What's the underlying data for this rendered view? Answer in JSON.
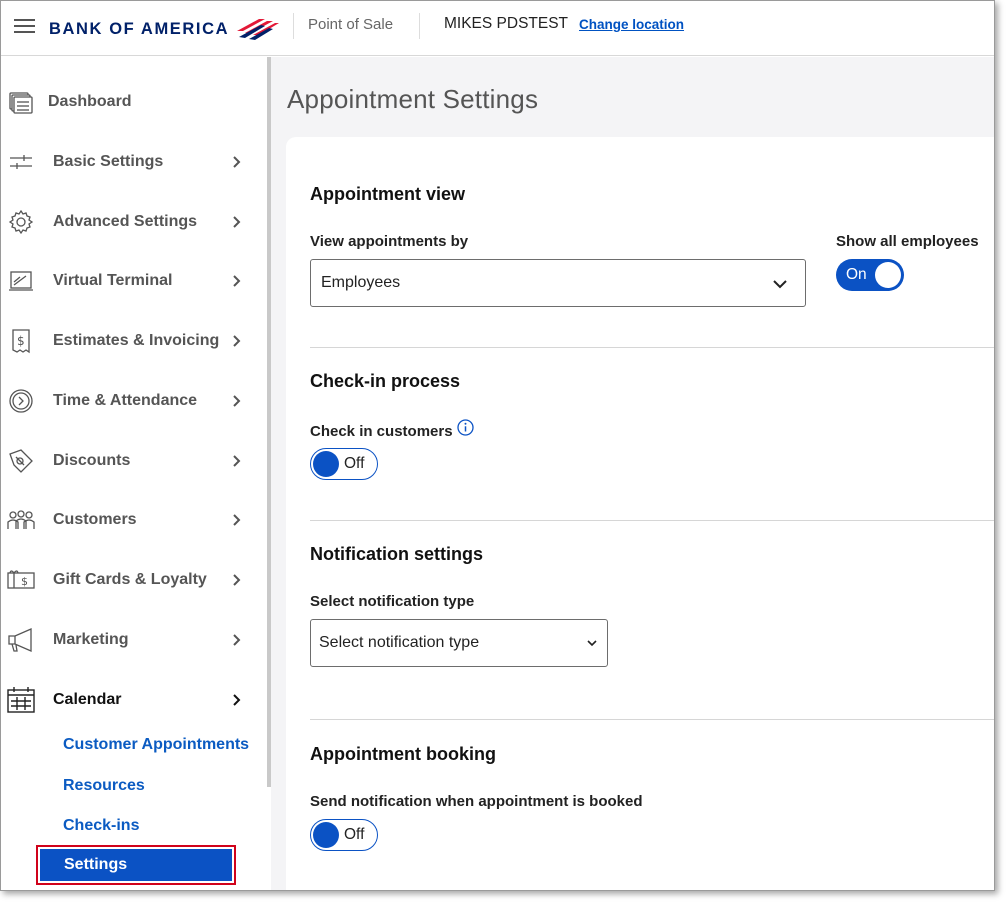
{
  "header": {
    "logo_text": "BANK OF AMERICA",
    "product": "Point of Sale",
    "merchant_name": "MIKES PDSTEST",
    "change_location": "Change location"
  },
  "sidebar": {
    "items": [
      {
        "label": "Dashboard",
        "icon": "dashboard-icon"
      },
      {
        "label": "Basic Settings",
        "icon": "sliders-icon"
      },
      {
        "label": "Advanced Settings",
        "icon": "gear-icon"
      },
      {
        "label": "Virtual Terminal",
        "icon": "terminal-icon"
      },
      {
        "label": "Estimates & Invoicing",
        "icon": "invoice-icon"
      },
      {
        "label": "Time & Attendance",
        "icon": "clock-icon"
      },
      {
        "label": "Discounts",
        "icon": "tag-icon"
      },
      {
        "label": "Customers",
        "icon": "people-icon"
      },
      {
        "label": "Gift Cards & Loyalty",
        "icon": "gift-card-icon"
      },
      {
        "label": "Marketing",
        "icon": "megaphone-icon"
      },
      {
        "label": "Calendar",
        "icon": "calendar-icon"
      }
    ],
    "calendar_sub": [
      "Customer Appointments",
      "Resources",
      "Check-ins",
      "Settings"
    ]
  },
  "main": {
    "title": "Appointment Settings",
    "appointment_view": {
      "title": "Appointment view",
      "view_by_label": "View appointments by",
      "view_by_value": "Employees",
      "show_all_label": "Show all employees",
      "show_all_state": "On"
    },
    "checkin": {
      "title": "Check-in process",
      "check_in_label": "Check in customers",
      "check_in_state": "Off"
    },
    "notification": {
      "title": "Notification settings",
      "type_label": "Select notification type",
      "type_value": "Select notification type"
    },
    "booking": {
      "title": "Appointment booking",
      "send_label": "Send notification when appointment is booked",
      "send_state": "Off"
    }
  },
  "colors": {
    "brand_navy": "#012169",
    "brand_red": "#e31837",
    "accent_blue": "#0b52c4",
    "highlight_red": "#d0021b"
  }
}
